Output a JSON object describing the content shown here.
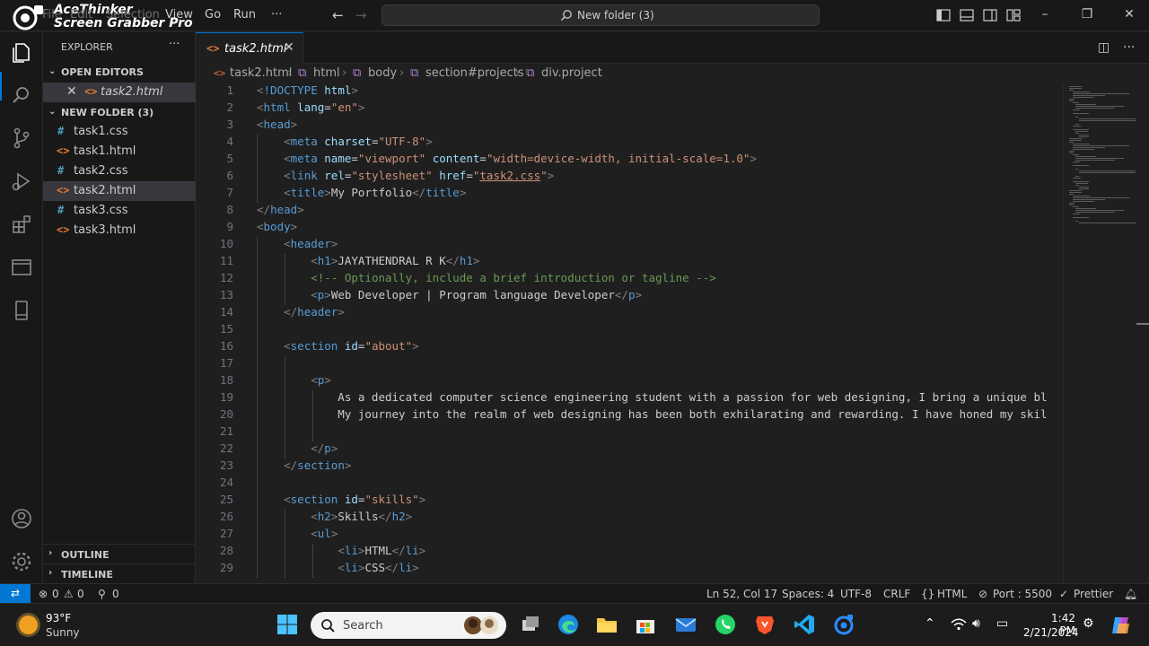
{
  "watermark": {
    "line1": "AceThinker",
    "line2": "Screen Grabber Pro"
  },
  "menu": [
    "File",
    "Edit",
    "Selection",
    "View",
    "Go",
    "Run",
    "···"
  ],
  "command_center": {
    "text": "New folder (3)"
  },
  "sidebar": {
    "title": "EXPLORER",
    "more": "···",
    "open_editors": {
      "label": "OPEN EDITORS",
      "items": [
        {
          "name": "task2.html"
        }
      ]
    },
    "folder": {
      "label": "NEW FOLDER (3)",
      "files": [
        {
          "name": "task1.css",
          "icon": "#"
        },
        {
          "name": "task1.html",
          "icon": "<>"
        },
        {
          "name": "task2.css",
          "icon": "#"
        },
        {
          "name": "task2.html",
          "icon": "<>"
        },
        {
          "name": "task3.css",
          "icon": "#"
        },
        {
          "name": "task3.html",
          "icon": "<>"
        }
      ]
    },
    "outline": "OUTLINE",
    "timeline": "TIMELINE"
  },
  "tab": {
    "name": "task2.html",
    "icon": "<>"
  },
  "breadcrumb": [
    "task2.html",
    "html",
    "body",
    "section#projects",
    "div.project"
  ],
  "code_lines": [
    {
      "n": "1",
      "text": "<!DOCTYPE html>"
    },
    {
      "n": "2",
      "text": "<html lang=\"en\">"
    },
    {
      "n": "3",
      "text": "<head>"
    },
    {
      "n": "4",
      "text": "    <meta charset=\"UTF-8\">"
    },
    {
      "n": "5",
      "text": "    <meta name=\"viewport\" content=\"width=device-width, initial-scale=1.0\">"
    },
    {
      "n": "6",
      "text": "    <link rel=\"stylesheet\" href=\"task2.css\">"
    },
    {
      "n": "7",
      "text": "    <title>My Portfolio</title>"
    },
    {
      "n": "8",
      "text": "</head>"
    },
    {
      "n": "9",
      "text": "<body>"
    },
    {
      "n": "10",
      "text": "    <header>"
    },
    {
      "n": "11",
      "text": "        <h1>JAYATHENDRAL R K</h1>"
    },
    {
      "n": "12",
      "text": "        <!-- Optionally, include a brief introduction or tagline -->"
    },
    {
      "n": "13",
      "text": "        <p>Web Developer | Program language Developer</p>"
    },
    {
      "n": "14",
      "text": "    </header>"
    },
    {
      "n": "15",
      "text": ""
    },
    {
      "n": "16",
      "text": "    <section id=\"about\">"
    },
    {
      "n": "17",
      "text": ""
    },
    {
      "n": "18",
      "text": "        <p>"
    },
    {
      "n": "19",
      "text": "            As a dedicated computer science engineering student with a passion for web designing, I bring a unique bl"
    },
    {
      "n": "20",
      "text": "            My journey into the realm of web designing has been both exhilarating and rewarding. I have honed my skil"
    },
    {
      "n": "21",
      "text": ""
    },
    {
      "n": "22",
      "text": "        </p>"
    },
    {
      "n": "23",
      "text": "    </section>"
    },
    {
      "n": "24",
      "text": ""
    },
    {
      "n": "25",
      "text": "    <section id=\"skills\">"
    },
    {
      "n": "26",
      "text": "        <h2>Skills</h2>"
    },
    {
      "n": "27",
      "text": "        <ul>"
    },
    {
      "n": "28",
      "text": "            <li>HTML</li>"
    },
    {
      "n": "29",
      "text": "            <li>CSS</li>"
    }
  ],
  "status": {
    "errors": "0",
    "warnings": "0",
    "ports": "0",
    "position": "Ln 52, Col 17",
    "spaces": "Spaces: 4",
    "encoding": "UTF-8",
    "eol": "CRLF",
    "language": "HTML",
    "port": "Port : 5500",
    "formatter": "Prettier"
  },
  "taskbar": {
    "weather_temp": "93°F",
    "weather_cond": "Sunny",
    "search_placeholder": "Search",
    "time": "1:42 PM",
    "date": "2/21/2024"
  },
  "colors": {
    "accent": "#0078d4",
    "html_icon": "#e37933",
    "css_icon": "#519aba"
  }
}
